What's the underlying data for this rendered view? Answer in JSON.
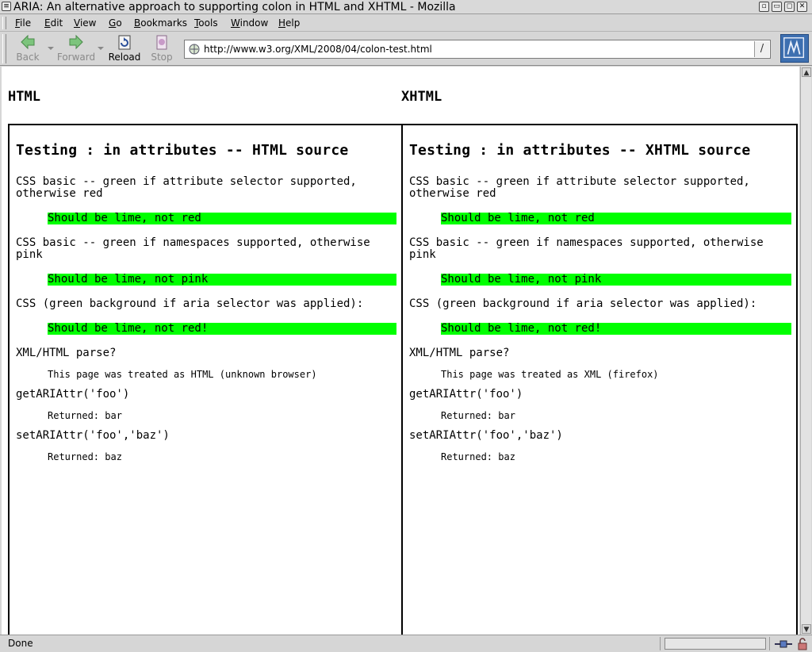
{
  "window": {
    "title": "ARIA: An alternative approach to supporting colon in HTML and XHTML - Mozilla"
  },
  "menubar": [
    "File",
    "Edit",
    "View",
    "Go",
    "Bookmarks",
    "Tools",
    "Window",
    "Help"
  ],
  "toolbar": {
    "back_label": "Back",
    "forward_label": "Forward",
    "reload_label": "Reload",
    "stop_label": "Stop"
  },
  "urlbar": {
    "value": "http://www.w3.org/XML/2008/04/colon-test.html",
    "go_label": "/"
  },
  "content": {
    "left_heading": "HTML",
    "right_heading": "XHTML",
    "left": {
      "title": "Testing : in attributes -- HTML source",
      "css_attr_desc": "CSS basic -- green if attribute selector supported, otherwise red",
      "css_attr_box": "Should be lime, not red",
      "css_ns_desc": "CSS basic -- green if namespaces supported, otherwise pink",
      "css_ns_box": "Should be lime, not pink",
      "css_aria_desc": "CSS (green background if aria selector was applied):",
      "css_aria_box": "Should be lime, not red!",
      "parse_desc": "XML/HTML parse?",
      "parse_result": "This page was treated as HTML (unknown browser)",
      "get_desc": "getARIAttr('foo')",
      "get_result": "Returned: bar",
      "set_desc": "setARIAttr('foo','baz')",
      "set_result": "Returned: baz"
    },
    "right": {
      "title": "Testing : in attributes -- XHTML source",
      "css_attr_desc": "CSS basic -- green if attribute selector supported, otherwise red",
      "css_attr_box": "Should be lime, not red",
      "css_ns_desc": "CSS basic -- green if namespaces supported, otherwise pink",
      "css_ns_box": "Should be lime, not pink",
      "css_aria_desc": "CSS (green background if aria selector was applied):",
      "css_aria_box": "Should be lime, not red!",
      "parse_desc": "XML/HTML parse?",
      "parse_result": "This page was treated as XML (firefox)",
      "get_desc": "getARIAttr('foo')",
      "get_result": "Returned: bar",
      "set_desc": "setARIAttr('foo','baz')",
      "set_result": "Returned: baz"
    }
  },
  "statusbar": {
    "status": "Done"
  },
  "colors": {
    "lime": "#00ff00",
    "throbber": "#3d6fb0"
  }
}
